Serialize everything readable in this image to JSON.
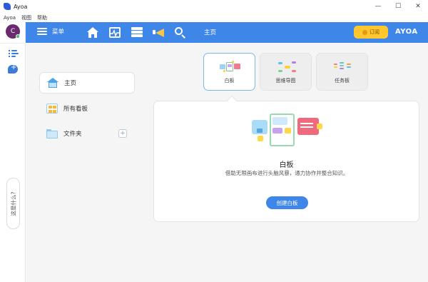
{
  "window": {
    "title": "Ayoa",
    "controls": {
      "minimize": "—",
      "maximize": "☐",
      "close": "✕"
    }
  },
  "menubar": [
    "Ayoa",
    "视图",
    "帮助"
  ],
  "rail": {
    "avatar_letter": "C",
    "help_label": "这是什么?"
  },
  "topbar": {
    "menu_label": "菜单",
    "breadcrumb": "主页",
    "subscribe_label": "订阅",
    "logo_text": "AYOA"
  },
  "sidebar": {
    "items": [
      {
        "label": "主页",
        "icon": "home-icon",
        "active": true
      },
      {
        "label": "所有看板",
        "icon": "boards-icon",
        "active": false
      },
      {
        "label": "文件夹",
        "icon": "folder-icon",
        "active": false
      }
    ],
    "add_folder": "+"
  },
  "type_tabs": [
    {
      "label": "白板",
      "active": true
    },
    {
      "label": "思维导图",
      "active": false
    },
    {
      "label": "任务板",
      "active": false
    }
  ],
  "card": {
    "title": "白板",
    "description": "借助无限画布进行头脑风暴，通力协作并整合知识。",
    "button_label": "创建白板"
  },
  "colors": {
    "accent_blue": "#3e86e8",
    "subscribe_yellow": "#ffc62e",
    "avatar_purple": "#6b2a6e"
  }
}
